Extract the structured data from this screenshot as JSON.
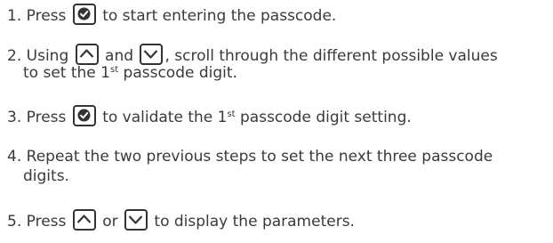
{
  "steps": [
    {
      "num": "1.",
      "a": "Press",
      "b": "to start entering the passcode."
    },
    {
      "num": "2.",
      "a": "Using",
      "b": "and",
      "c": ", scroll through the different possible values",
      "d": "to set the 1",
      "sup": "st",
      "e": " passcode digit."
    },
    {
      "num": "3.",
      "a": "Press",
      "b": "to validate the 1",
      "sup": "st",
      "c": " passcode digit setting."
    },
    {
      "num": "4.",
      "a": "Repeat the two previous steps to set the next three passcode",
      "b": "digits."
    },
    {
      "num": "5.",
      "a": "Press",
      "b": "or",
      "c": "to display the parameters."
    }
  ],
  "icons": {
    "validate": "check-circle-icon",
    "up": "chevron-up-icon",
    "down": "chevron-down-icon"
  },
  "colors": {
    "text": "#3a3a3a",
    "icon": "#333333"
  }
}
